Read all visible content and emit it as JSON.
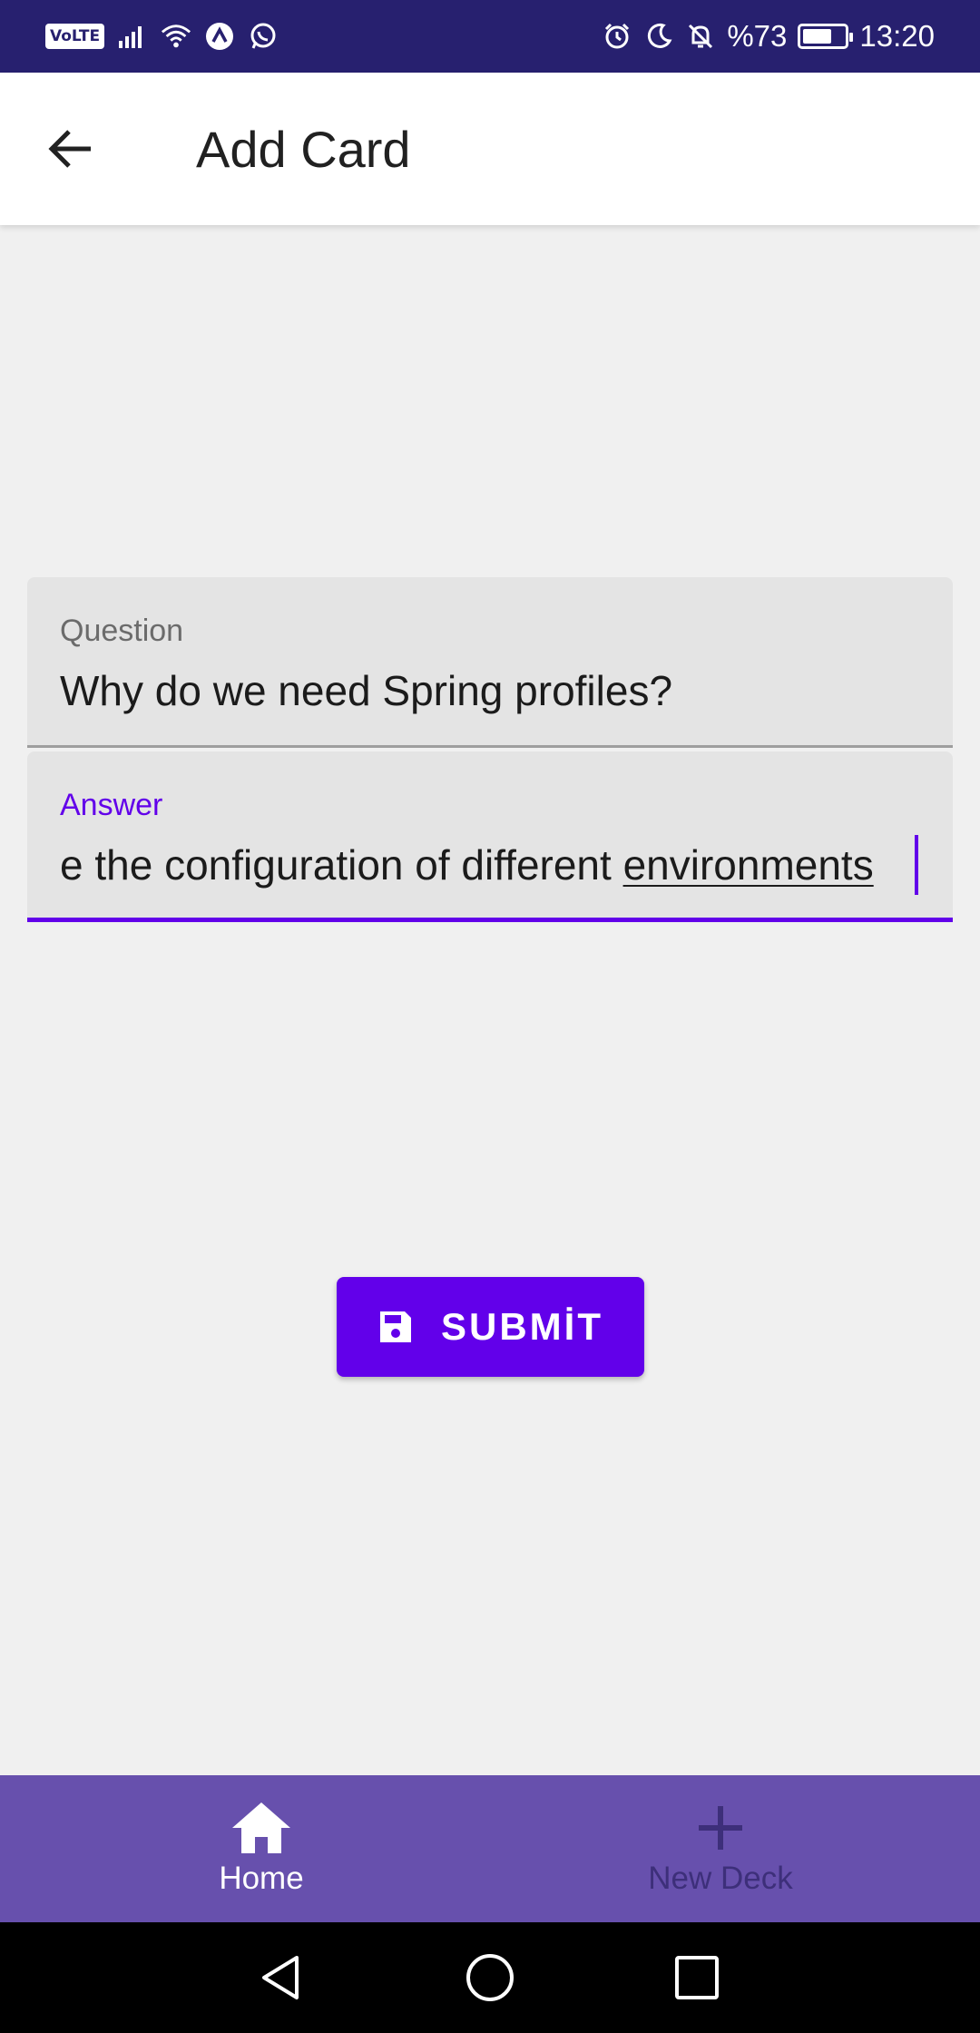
{
  "status_bar": {
    "volte": "VoLTE",
    "battery_text": "%73",
    "battery_level": 0.73,
    "time": "13:20"
  },
  "app_bar": {
    "title": "Add Card"
  },
  "form": {
    "question": {
      "label": "Question",
      "value": "Why do we need Spring profiles?"
    },
    "answer": {
      "label": "Answer",
      "value_visible": "e the configuration of different ",
      "value_last_word": "environments"
    }
  },
  "submit": {
    "label": "SUBMİT",
    "icon": "save-icon"
  },
  "bottom_nav": {
    "items": [
      {
        "label": "Home",
        "icon": "home-icon"
      },
      {
        "label": "New Deck",
        "icon": "plus-icon"
      }
    ]
  },
  "colors": {
    "status_bar": "#27206f",
    "accent": "#6200ea",
    "bottom_nav": "#6750ad"
  }
}
